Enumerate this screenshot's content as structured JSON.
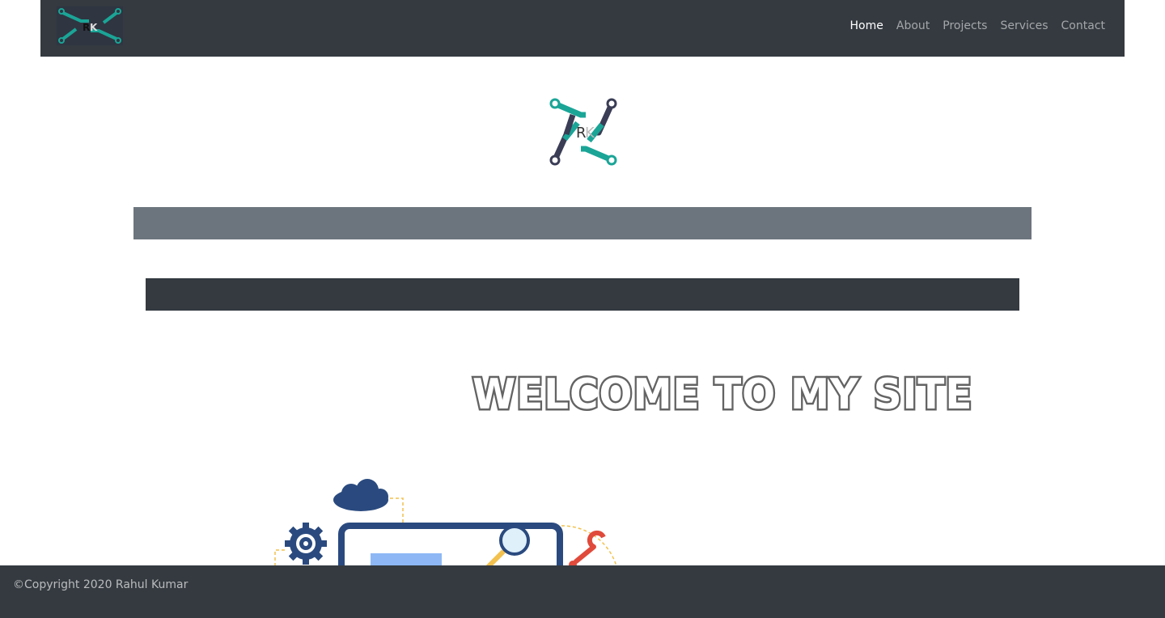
{
  "nav": {
    "logo_icon": "rk-logo-icon",
    "links": [
      {
        "label": "Home",
        "active": true
      },
      {
        "label": "About",
        "active": false
      },
      {
        "label": "Projects",
        "active": false
      },
      {
        "label": "Services",
        "active": false
      },
      {
        "label": "Contact",
        "active": false
      }
    ]
  },
  "hero": {
    "logo_icon": "rk-logo-icon",
    "heading": "Welcome to my site",
    "illustration_icon": "web-development-illustration"
  },
  "footer": {
    "copyright": "©Copyright 2020 Rahul Kumar"
  },
  "colors": {
    "nav_bg": "#343a40",
    "gray_bar": "#6c757d",
    "dark_bar": "#343a40",
    "teal": "#1aa597",
    "navy": "#3a3d55",
    "heading_stroke": "#636363"
  }
}
